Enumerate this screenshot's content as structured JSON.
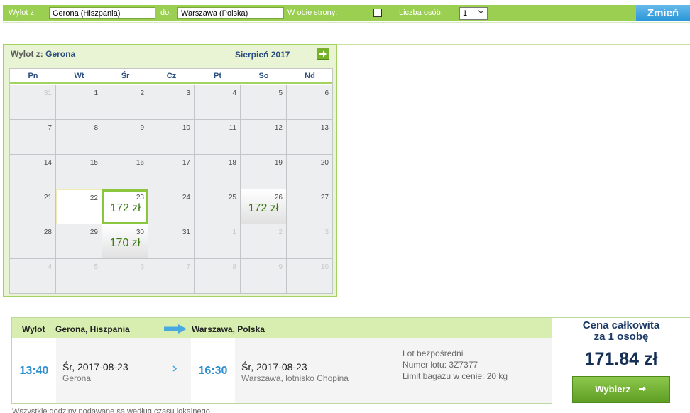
{
  "search": {
    "from_label": "Wylot z:",
    "from_value": "Gerona (Hiszpania)",
    "to_label": "do:",
    "to_value": "Warszawa (Polska)",
    "roundtrip_label": "W obie strony:",
    "roundtrip_checked": false,
    "passengers_label": "Liczba osób:",
    "passengers_value": "1",
    "change_button": "Zmień"
  },
  "calendar": {
    "from_label": "Wylot z:",
    "from_city": "Gerona",
    "month": "Sierpień 2017",
    "next_icon": "arrow-right-icon",
    "weekdays": [
      "Pn",
      "Wt",
      "Śr",
      "Cz",
      "Pt",
      "So",
      "Nd"
    ],
    "weeks": [
      [
        {
          "day": "31",
          "muted": true
        },
        {
          "day": "1"
        },
        {
          "day": "2"
        },
        {
          "day": "3"
        },
        {
          "day": "4"
        },
        {
          "day": "5"
        },
        {
          "day": "6"
        }
      ],
      [
        {
          "day": "7"
        },
        {
          "day": "8"
        },
        {
          "day": "9"
        },
        {
          "day": "10"
        },
        {
          "day": "11"
        },
        {
          "day": "12"
        },
        {
          "day": "13"
        }
      ],
      [
        {
          "day": "14"
        },
        {
          "day": "15"
        },
        {
          "day": "16"
        },
        {
          "day": "17"
        },
        {
          "day": "18"
        },
        {
          "day": "19"
        },
        {
          "day": "20"
        }
      ],
      [
        {
          "day": "21"
        },
        {
          "day": "22",
          "outline": true
        },
        {
          "day": "23",
          "price": "172 zł",
          "selected": true
        },
        {
          "day": "24"
        },
        {
          "day": "25"
        },
        {
          "day": "26",
          "price": "172 zł"
        },
        {
          "day": "27"
        }
      ],
      [
        {
          "day": "28"
        },
        {
          "day": "29"
        },
        {
          "day": "30",
          "price": "170 zł"
        },
        {
          "day": "31"
        },
        {
          "day": "1",
          "muted": true
        },
        {
          "day": "2",
          "muted": true
        },
        {
          "day": "3",
          "muted": true
        }
      ],
      [
        {
          "day": "4",
          "muted": true
        },
        {
          "day": "5",
          "muted": true
        },
        {
          "day": "6",
          "muted": true
        },
        {
          "day": "7",
          "muted": true
        },
        {
          "day": "8",
          "muted": true
        },
        {
          "day": "9",
          "muted": true
        },
        {
          "day": "10",
          "muted": true
        }
      ]
    ]
  },
  "flight": {
    "header_label": "Wylot",
    "origin": "Gerona, Hiszpania",
    "destination": "Warszawa, Polska",
    "depart_time": "13:40",
    "depart_date": "Śr, 2017-08-23",
    "depart_place": "Gerona",
    "arrive_time": "16:30",
    "arrive_date": "Śr, 2017-08-23",
    "arrive_place": "Warszawa, lotnisko Chopina",
    "info_direct": "Lot bezpośredni",
    "info_flight_no": "Numer lotu: 3Z7377",
    "info_baggage": "Limit bagażu w cenie: 20 kg"
  },
  "price": {
    "title_line1": "Cena całkowita",
    "title_line2": "za 1 osobę",
    "total": "171.84 zł",
    "select_button": "Wybierz",
    "select_icon": "arrow-right-icon"
  },
  "footnote": "Wszystkie godziny podawane są według czasu lokalnego"
}
